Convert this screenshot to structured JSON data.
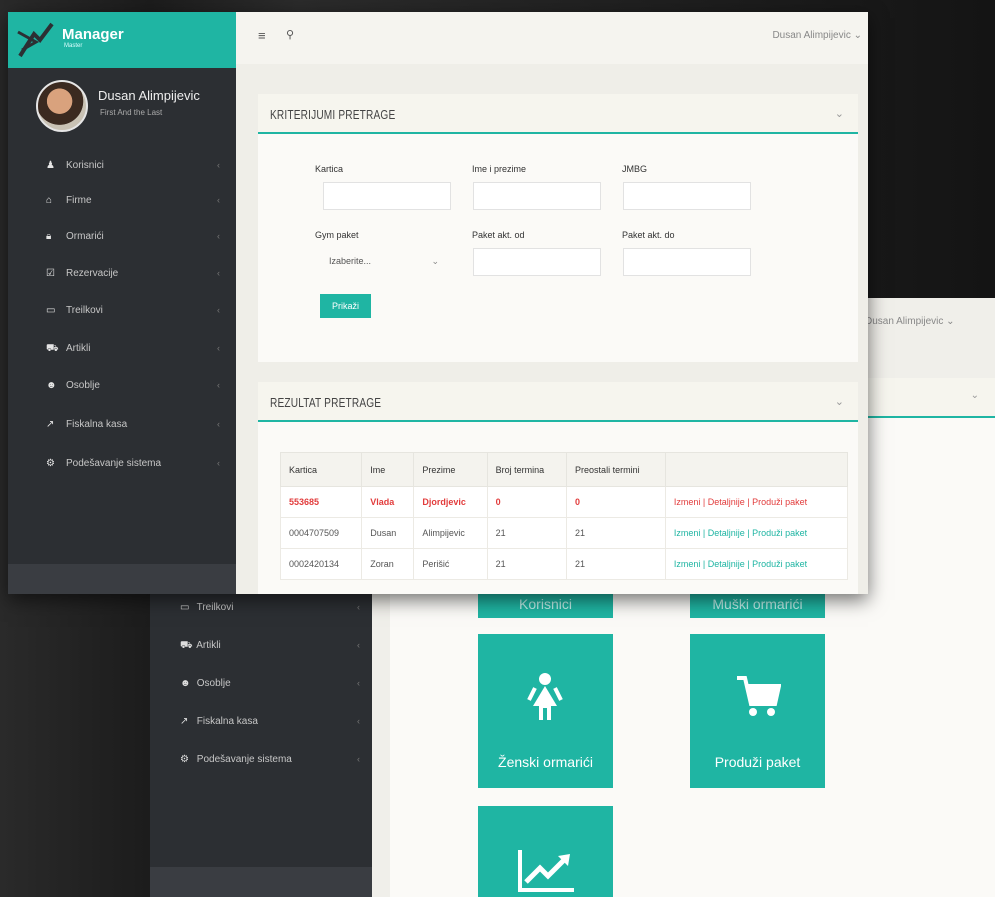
{
  "app": {
    "name": "Manager",
    "subtitle": "Master"
  },
  "user": {
    "name": "Dusan Alimpijevic",
    "role": "First And the Last",
    "dropdown_label": "Dusan Alimpijevic"
  },
  "sidebar": {
    "items": [
      {
        "icon": "user-icon",
        "label": "Korisnici"
      },
      {
        "icon": "building-icon",
        "label": "Firme"
      },
      {
        "icon": "lock-icon",
        "label": "Ormarići"
      },
      {
        "icon": "check-icon",
        "label": "Rezervacije"
      },
      {
        "icon": "card-icon",
        "label": "Treilkovi"
      },
      {
        "icon": "cart-icon",
        "label": "Artikli"
      },
      {
        "icon": "group-icon",
        "label": "Osoblje"
      },
      {
        "icon": "chart-icon",
        "label": "Fiskalna kasa"
      },
      {
        "icon": "gears-icon",
        "label": "Podešavanje sistema"
      }
    ]
  },
  "background_window": {
    "user_dropdown": "Dusan Alimpijevic",
    "sidebar_items": [
      {
        "icon": "card-icon",
        "label": "Treilkovi"
      },
      {
        "icon": "cart-icon",
        "label": "Artikli"
      },
      {
        "icon": "group-icon",
        "label": "Osoblje"
      },
      {
        "icon": "chart-icon",
        "label": "Fiskalna kasa"
      },
      {
        "icon": "gears-icon",
        "label": "Podešavanje sistema"
      }
    ],
    "tiles": {
      "korisnici": "Korisnici",
      "muski": "Muški ormarići",
      "zenski": "Ženski ormarići",
      "produzi": "Produži paket"
    }
  },
  "search_panel": {
    "title": "KRITERIJUMI PRETRAGE",
    "fields": {
      "kartica": "Kartica",
      "ime": "Ime i prezime",
      "jmbg": "JMBG",
      "gym": "Gym paket",
      "paket_od": "Paket akt. od",
      "paket_do": "Paket akt. do"
    },
    "select_value": "Izaberite...",
    "search_button": "Prikaži"
  },
  "results_panel": {
    "title": "REZULTAT PRETRAGE",
    "columns": [
      "Kartica",
      "Ime",
      "Prezime",
      "Broj termina",
      "Preostali termini",
      ""
    ],
    "rows": [
      {
        "kartica": "553685",
        "ime": "Vlada",
        "prezime": "Djordjevic",
        "broj": "0",
        "preostali": "0",
        "highlight": true
      },
      {
        "kartica": "0004707509",
        "ime": "Dusan",
        "prezime": "Alimpijevic",
        "broj": "21",
        "preostali": "21",
        "highlight": false
      },
      {
        "kartica": "0002420134",
        "ime": "Zoran",
        "prezime": "Perišić",
        "broj": "21",
        "preostali": "21",
        "highlight": false
      }
    ],
    "actions": {
      "izmeni": "Izmeni",
      "detaljnije": "Detaljnije",
      "produzi": "Produži paket",
      "sep": "|"
    }
  },
  "colors": {
    "accent": "#1fb5a3",
    "sidebar": "#2c2f33",
    "danger": "#e23c3c"
  }
}
